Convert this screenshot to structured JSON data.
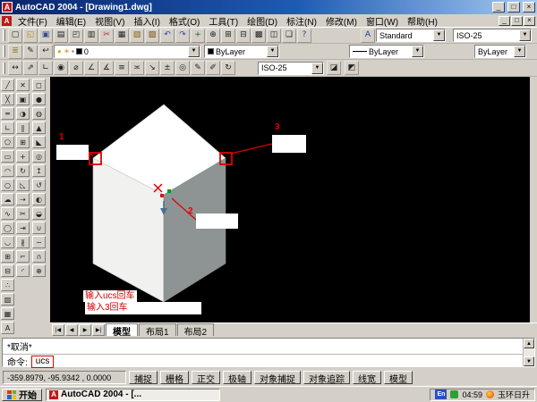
{
  "ui": {
    "app_letter": "A",
    "dropdown_glyph": "▼",
    "up_glyph": "▲",
    "down_glyph": "▼",
    "min_glyph": "_",
    "max_glyph": "□",
    "close_glyph": "×"
  },
  "titlebar": {
    "title": "AutoCAD 2004 - [Drawing1.dwg]"
  },
  "menubar": {
    "items": [
      "文件(F)",
      "编辑(E)",
      "视图(V)",
      "插入(I)",
      "格式(O)",
      "工具(T)",
      "绘图(D)",
      "标注(N)",
      "修改(M)",
      "窗口(W)",
      "帮助(H)"
    ]
  },
  "toolbar_standard": {
    "icons": [
      {
        "n": "new-file-icon",
        "g": "▢"
      },
      {
        "n": "open-file-icon",
        "g": "◱",
        "c": "#b8860b"
      },
      {
        "n": "save-icon",
        "g": "▣",
        "c": "#33518e"
      },
      {
        "n": "plot-icon",
        "g": "▤"
      },
      {
        "n": "plot-preview-icon",
        "g": "◰"
      },
      {
        "n": "publish-icon",
        "g": "▥"
      },
      {
        "n": "cut-icon",
        "g": "✂",
        "c": "#a03030"
      },
      {
        "n": "copy-icon",
        "g": "▦"
      },
      {
        "n": "paste-icon",
        "g": "▧",
        "c": "#8a6a10"
      },
      {
        "n": "match-properties-icon",
        "g": "▨",
        "c": "#7a4a10"
      },
      {
        "n": "undo-icon",
        "g": "↶",
        "c": "#2a4aa0"
      },
      {
        "n": "redo-icon",
        "g": "↷",
        "c": "#2a4aa0"
      },
      {
        "n": "pan-icon",
        "g": "+",
        "c": "#207020"
      },
      {
        "n": "zoom-realtime-icon",
        "g": "⊕"
      },
      {
        "n": "zoom-window-icon",
        "g": "⊞"
      },
      {
        "n": "zoom-previous-icon",
        "g": "⊟"
      },
      {
        "n": "properties-icon",
        "g": "▩"
      },
      {
        "n": "designcenter-icon",
        "g": "◫"
      },
      {
        "n": "tool-palettes-icon",
        "g": "❏"
      },
      {
        "n": "help-icon",
        "g": "?",
        "c": "#20409a"
      }
    ],
    "text_style_icon_glyph": "A",
    "text_style_value": "Standard",
    "dim_style_value": "ISO-25"
  },
  "toolbar_properties": {
    "icons": [
      {
        "n": "layer-manager-icon",
        "g": "≣",
        "c": "#9a7a20"
      },
      {
        "n": "make-layer-current-icon",
        "g": "✎"
      },
      {
        "n": "layer-previous-icon",
        "g": "↩"
      }
    ],
    "layer_bulb_glyph": "●",
    "layer_sun_glyph": "☀",
    "layer_lock_glyph": "▪",
    "layer_value": "0",
    "color_value": "ByLayer",
    "linetype_value": "ByLayer",
    "lineweight_value": "ByLayer"
  },
  "toolbar_dimension": {
    "icons_left": [
      {
        "n": "linear-dim-icon",
        "g": "↔"
      },
      {
        "n": "aligned-dim-icon",
        "g": "⇗"
      },
      {
        "n": "ordinate-dim-icon",
        "g": "∟"
      },
      {
        "n": "radius-dim-icon",
        "g": "◉"
      },
      {
        "n": "diameter-dim-icon",
        "g": "⌀"
      },
      {
        "n": "angular-dim-icon",
        "g": "∠"
      },
      {
        "n": "quick-dim-icon",
        "g": "∡"
      },
      {
        "n": "baseline-dim-icon",
        "g": "≡"
      },
      {
        "n": "continue-dim-icon",
        "g": "≍"
      },
      {
        "n": "quick-leader-icon",
        "g": "↘"
      },
      {
        "n": "tolerance-icon",
        "g": "±"
      },
      {
        "n": "center-mark-icon",
        "g": "◎"
      },
      {
        "n": "dim-edit-icon",
        "g": "✎"
      },
      {
        "n": "dim-text-edit-icon",
        "g": "✐"
      },
      {
        "n": "dim-update-icon",
        "g": "↻"
      }
    ],
    "dim_style_value": "ISO-25",
    "icons_right": [
      {
        "n": "dim-style-manager-icon",
        "g": "◪"
      },
      {
        "n": "dim-override-icon",
        "g": "◩"
      }
    ]
  },
  "draw_toolbar": {
    "icons": [
      {
        "n": "line-icon",
        "g": "╱"
      },
      {
        "n": "construction-line-icon",
        "g": "╳"
      },
      {
        "n": "multiline-icon",
        "g": "═"
      },
      {
        "n": "polyline-icon",
        "g": "∟"
      },
      {
        "n": "polygon-icon",
        "g": "⬠"
      },
      {
        "n": "rectangle-icon",
        "g": "▭"
      },
      {
        "n": "arc-icon",
        "g": "◠"
      },
      {
        "n": "circle-icon",
        "g": "○"
      },
      {
        "n": "revision-cloud-icon",
        "g": "☁"
      },
      {
        "n": "spline-icon",
        "g": "∿"
      },
      {
        "n": "ellipse-icon",
        "g": "◯"
      },
      {
        "n": "ellipse-arc-icon",
        "g": "◡"
      },
      {
        "n": "insert-block-icon",
        "g": "⊞"
      },
      {
        "n": "make-block-icon",
        "g": "⊟"
      },
      {
        "n": "point-icon",
        "g": "∴"
      },
      {
        "n": "hatch-icon",
        "g": "▨"
      },
      {
        "n": "region-icon",
        "g": "▦"
      },
      {
        "n": "mtext-icon",
        "g": "A"
      }
    ]
  },
  "modify_toolbar": {
    "icons": [
      {
        "n": "erase-icon",
        "g": "✕"
      },
      {
        "n": "copy-object-icon",
        "g": "▣"
      },
      {
        "n": "mirror-icon",
        "g": "◑"
      },
      {
        "n": "offset-icon",
        "g": "∥"
      },
      {
        "n": "array-icon",
        "g": "⊞"
      },
      {
        "n": "move-icon",
        "g": "+"
      },
      {
        "n": "rotate-icon",
        "g": "↻"
      },
      {
        "n": "scale-icon",
        "g": "◺"
      },
      {
        "n": "stretch-icon",
        "g": "⇢"
      },
      {
        "n": "trim-icon",
        "g": "✂"
      },
      {
        "n": "extend-icon",
        "g": "⇥"
      },
      {
        "n": "break-icon",
        "g": "∦"
      },
      {
        "n": "chamfer-icon",
        "g": "⌐"
      },
      {
        "n": "fillet-icon",
        "g": "◜"
      }
    ]
  },
  "solids_toolbar": {
    "icons": [
      {
        "n": "box-icon",
        "g": "◻"
      },
      {
        "n": "sphere-icon",
        "g": "●"
      },
      {
        "n": "cylinder-icon",
        "g": "◍"
      },
      {
        "n": "cone-icon",
        "g": "▲"
      },
      {
        "n": "wedge-icon",
        "g": "◣"
      },
      {
        "n": "torus-icon",
        "g": "◎"
      },
      {
        "n": "extrude-icon",
        "g": "↥"
      },
      {
        "n": "revolve-icon",
        "g": "↺"
      },
      {
        "n": "slice-icon",
        "g": "◐"
      },
      {
        "n": "section-icon",
        "g": "◒"
      },
      {
        "n": "union-icon",
        "g": "∪"
      },
      {
        "n": "subtract-icon",
        "g": "−"
      },
      {
        "n": "intersect-icon",
        "g": "∩"
      },
      {
        "n": "orbit-icon",
        "g": "⊕"
      }
    ]
  },
  "canvas": {
    "marker1": "1",
    "marker2": "2",
    "marker3": "3",
    "note_line1": "输入ucs回车",
    "note_line2": "输入3回车"
  },
  "tabs": {
    "nav": [
      "|◀",
      "◀",
      "▶",
      "▶|"
    ],
    "model": "模型",
    "layout1": "布局1",
    "layout2": "布局2"
  },
  "command": {
    "history1": "*取消*",
    "prompt": "命令:",
    "input": "ucs"
  },
  "statusbar": {
    "coords": "-359.8979, -95.9342 ,  0.0000",
    "buttons": [
      "捕捉",
      "栅格",
      "正交",
      "极轴",
      "对象捕捉",
      "对象追踪",
      "线宽",
      "模型"
    ]
  },
  "taskbar": {
    "start": "开始",
    "task": "AutoCAD 2004 - [...",
    "lang": "En",
    "time": "04:59",
    "tray_text": "玉环日升"
  }
}
